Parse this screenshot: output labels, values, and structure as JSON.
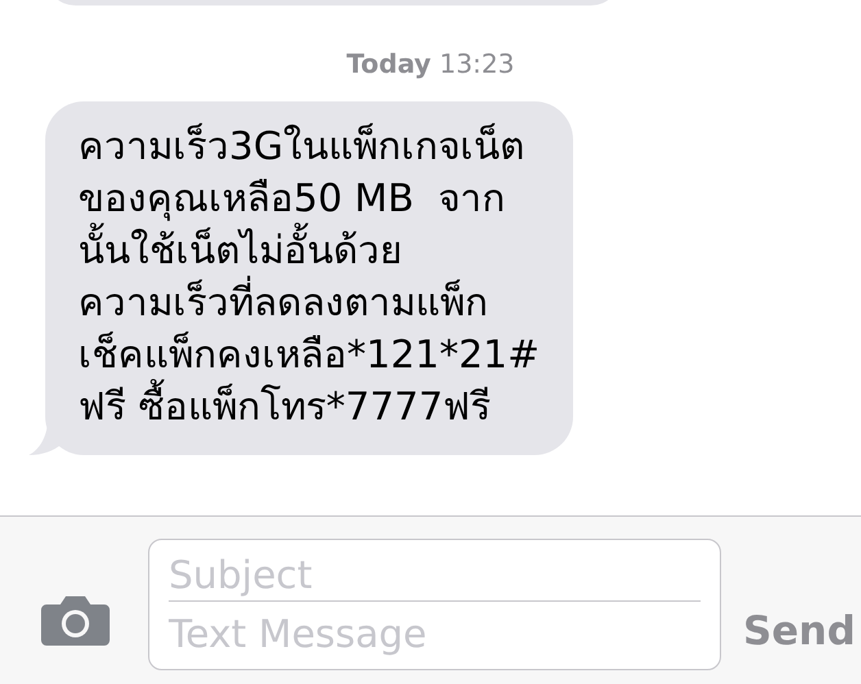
{
  "timestamp": {
    "day": "Today",
    "time": "13:23"
  },
  "messages": [
    {
      "kind": "partial"
    },
    {
      "kind": "incoming",
      "lines": [
        "ความเร็ว3Gในแพ็กเกจเน็ต",
        "ของคุณเหลือ50 MB  จาก",
        "นั้นใช้เน็ตไม่อั้นด้วย",
        "ความเร็วที่ลดลงตามแพ็ก",
        "เช็คแพ็กคงเหลือ*121*21#",
        "ฟรี ซื้อแพ็กโทร*7777ฟรี"
      ]
    }
  ],
  "composer": {
    "subject_placeholder": "Subject",
    "message_placeholder": "Text Message",
    "send": "Send"
  }
}
